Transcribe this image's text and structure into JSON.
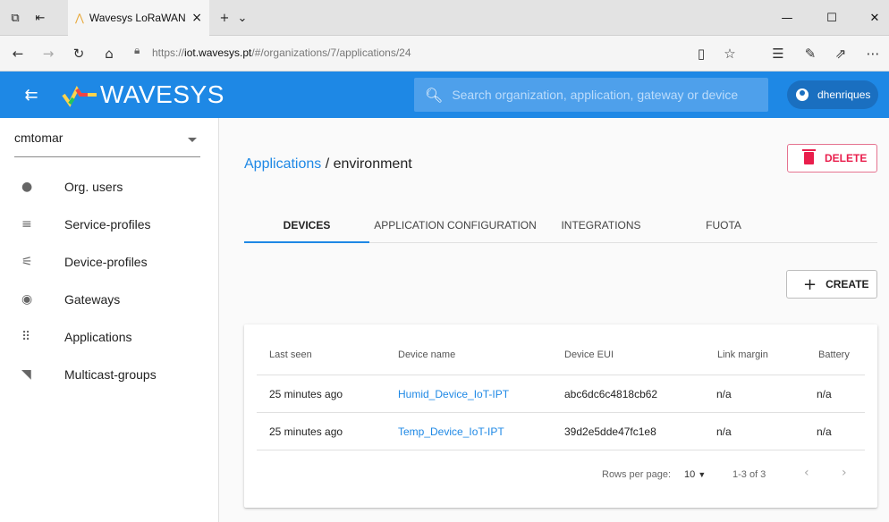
{
  "browser": {
    "tab_title": "Wavesys LoRaWAN Sen",
    "url_prefix": "https://",
    "url_host": "iot.wavesys.pt",
    "url_path": "/#/organizations/7/applications/24"
  },
  "appbar": {
    "logo_text": "WAVESYS",
    "search_placeholder": "Search organization, application, gateway or device",
    "username": "dhenriques",
    "color": "#1e88e5"
  },
  "sidebar": {
    "organization": "cmtomar",
    "items": [
      {
        "label": "Org. users",
        "icon": "person-icon"
      },
      {
        "label": "Service-profiles",
        "icon": "service-profiles-icon"
      },
      {
        "label": "Device-profiles",
        "icon": "tune-icon"
      },
      {
        "label": "Gateways",
        "icon": "gateway-icon"
      },
      {
        "label": "Applications",
        "icon": "apps-grid-icon"
      },
      {
        "label": "Multicast-groups",
        "icon": "rss-icon"
      }
    ]
  },
  "main": {
    "breadcrumb_link": "Applications",
    "breadcrumb_sep": " / ",
    "breadcrumb_current": "environment",
    "delete_label": "DELETE",
    "create_label": "CREATE",
    "tabs": [
      "DEVICES",
      "APPLICATION CONFIGURATION",
      "INTEGRATIONS",
      "FUOTA"
    ],
    "active_tab": "DEVICES"
  },
  "table": {
    "columns": [
      "Last seen",
      "Device name",
      "Device EUI",
      "Link margin",
      "Battery"
    ],
    "rows": [
      {
        "last_seen": "25 minutes ago",
        "name": "Humid_Device_IoT-IPT",
        "eui": "abc6dc6c4818cb62",
        "link_margin": "n/a",
        "battery": "n/a"
      },
      {
        "last_seen": "25 minutes ago",
        "name": "Temp_Device_IoT-IPT",
        "eui": "39d2e5dde47fc1e8",
        "link_margin": "n/a",
        "battery": "n/a"
      }
    ],
    "rows_per_page_label": "Rows per page:",
    "rows_per_page": "10",
    "range": "1-3 of 3"
  }
}
